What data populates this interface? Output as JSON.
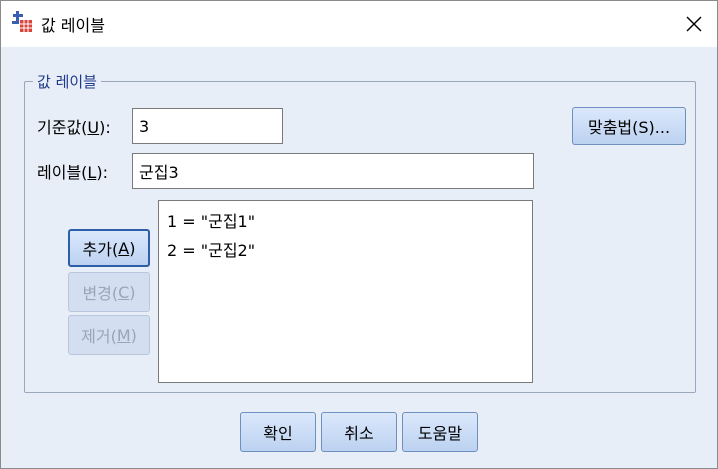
{
  "window": {
    "title": "값 레이블",
    "close_glyph": "✕"
  },
  "group": {
    "legend": "값 레이블"
  },
  "value_field": {
    "label_main": "기준값(",
    "label_mnemonic": "U",
    "label_end": "):",
    "value": "3"
  },
  "label_field": {
    "label_main": "레이블(",
    "label_mnemonic": "L",
    "label_end": "):",
    "value": "군집3"
  },
  "spelling_button": {
    "label": "맞춤법(S)..."
  },
  "list": {
    "items": [
      "1 = \"군집1\"",
      "2 = \"군집2\""
    ]
  },
  "buttons": {
    "add": {
      "main": "추가(",
      "mnemonic": "A",
      "end": ")"
    },
    "change": {
      "main": "변경(",
      "mnemonic": "C",
      "end": ")"
    },
    "remove": {
      "main": "제거(",
      "mnemonic": "M",
      "end": ")"
    }
  },
  "footer": {
    "ok": "확인",
    "cancel": "취소",
    "help": "도움말"
  },
  "colors": {
    "background": "#e8eef8",
    "legend_text": "#1f3a8a",
    "button_border": "#6f8fbf"
  }
}
